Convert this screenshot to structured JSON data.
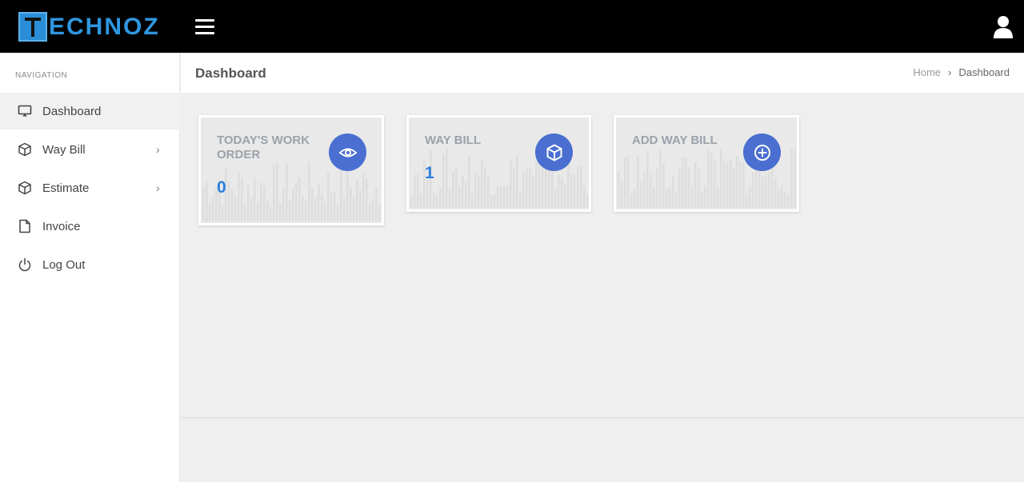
{
  "header": {
    "logo_text": "ECHNOZ",
    "menu_icon": "hamburger-icon",
    "user_icon": "user-icon"
  },
  "sidebar": {
    "title": "NAVIGATION",
    "items": [
      {
        "label": "Dashboard",
        "icon": "monitor-icon",
        "active": true,
        "chevron": ""
      },
      {
        "label": "Way Bill",
        "icon": "cube-icon",
        "active": false,
        "chevron": "›"
      },
      {
        "label": "Estimate",
        "icon": "cube-icon",
        "active": false,
        "chevron": "›"
      },
      {
        "label": "Invoice",
        "icon": "file-icon",
        "active": false,
        "chevron": ""
      },
      {
        "label": "Log Out",
        "icon": "power-icon",
        "active": false,
        "chevron": ""
      }
    ]
  },
  "page": {
    "title": "Dashboard",
    "breadcrumb": {
      "home": "Home",
      "separator": "›",
      "current": "Dashboard"
    }
  },
  "cards": [
    {
      "title": "TODAY'S WORK ORDER",
      "value": "0",
      "icon": "eye-icon"
    },
    {
      "title": "WAY BILL",
      "value": "1",
      "icon": "cube-icon"
    },
    {
      "title": "ADD WAY BILL",
      "value": "",
      "icon": "plus-circle-icon"
    }
  ],
  "colors": {
    "accent": "#4a6fd1",
    "value": "#2a7fdc",
    "topbar": "#000000",
    "logo": "#2f97e0"
  }
}
